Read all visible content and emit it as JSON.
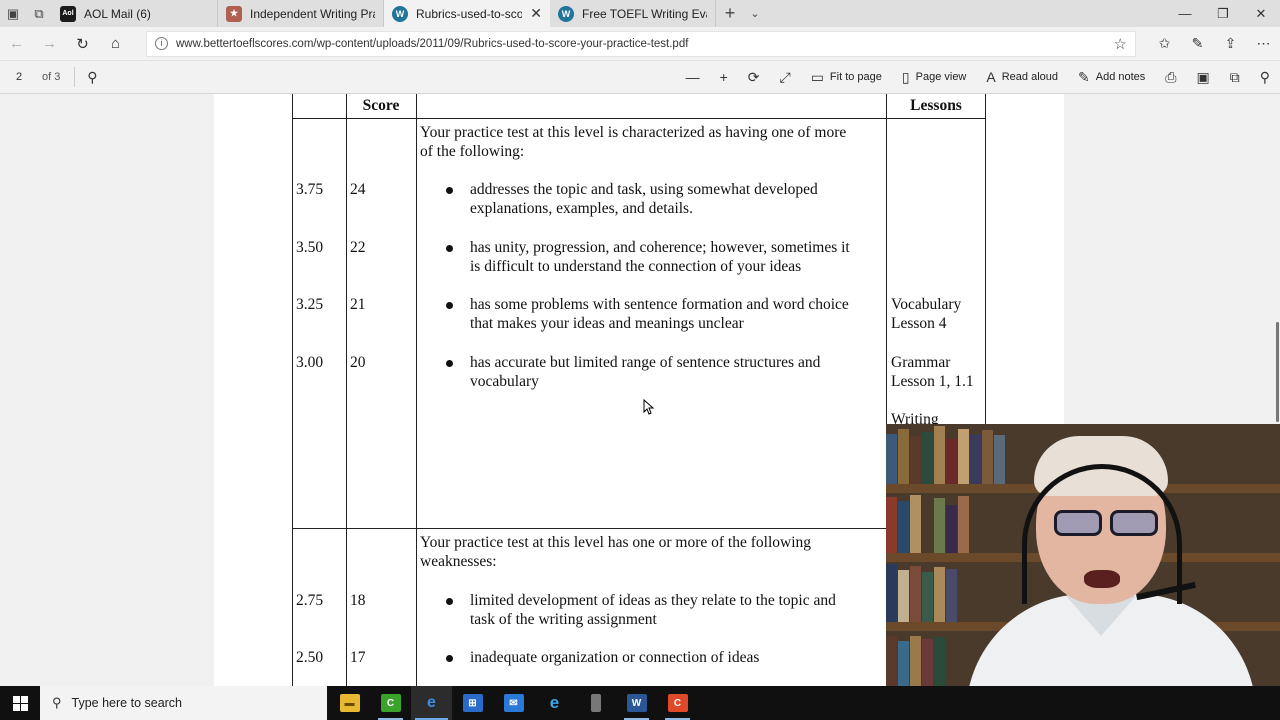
{
  "browser": {
    "tabs": [
      {
        "title": "AOL Mail (6)",
        "fav_text": "Aol",
        "fav_color": "#1a1a1a",
        "active": false
      },
      {
        "title": "Independent Writing Practic",
        "fav_text": "★",
        "fav_color": "#b06050",
        "active": false
      },
      {
        "title": "Rubrics-used-to-score-y",
        "fav_text": "W",
        "fav_color": "#21759b",
        "active": true
      },
      {
        "title": "Free TOEFL Writing Evaluati",
        "fav_text": "W",
        "fav_color": "#21759b",
        "active": false
      }
    ],
    "close_tab_glyph": "✕",
    "new_tab_glyph": "+",
    "url": "www.bettertoeflscores.com/wp-content/uploads/2011/09/Rubrics-used-to-score-your-practice-test.pdf"
  },
  "pdf_toolbar": {
    "page_current": "2",
    "page_total": "of 3",
    "fit_to_page": "Fit to page",
    "page_view": "Page view",
    "read_aloud": "Read aloud",
    "add_notes": "Add notes"
  },
  "document": {
    "header_score": "Score",
    "header_lessons": "Lessons",
    "section1_intro_l1": "Your practice test at this level is characterized as having one of more",
    "section1_intro_l2": "of the following:",
    "rows1": [
      {
        "level": "3.75",
        "score": "24",
        "l1": "addresses the topic and task, using somewhat developed",
        "l2": "explanations, examples, and details.",
        "lesson_l1": "",
        "lesson_l2": ""
      },
      {
        "level": "3.50",
        "score": "22",
        "l1": "has unity, progression, and coherence; however, sometimes it",
        "l2": "is difficult to understand the connection of your ideas",
        "lesson_l1": "",
        "lesson_l2": ""
      },
      {
        "level": "3.25",
        "score": "21",
        "l1": "has some problems with sentence formation and word choice",
        "l2": "that makes your ideas and meanings unclear",
        "lesson_l1": "Vocabulary",
        "lesson_l2": "Lesson 4"
      },
      {
        "level": "3.00",
        "score": "20",
        "l1": "has accurate but limited range of sentence structures and",
        "l2": "vocabulary",
        "lesson_l1": "Grammar",
        "lesson_l2": "Lesson 1, 1.1"
      }
    ],
    "lesson_writing": "Writing",
    "section2_intro_l1": "Your practice test at this level has one or more of the following",
    "section2_intro_l2": "weaknesses:",
    "rows2": [
      {
        "level": "2.75",
        "score": "18",
        "l1": "limited development of ideas as they relate to the topic and",
        "l2": "task of the writing assignment"
      },
      {
        "level": "2.50",
        "score": "17",
        "l1": "inadequate organization or connection of ideas",
        "l2": ""
      }
    ]
  },
  "taskbar": {
    "search_placeholder": "Type here to search"
  }
}
